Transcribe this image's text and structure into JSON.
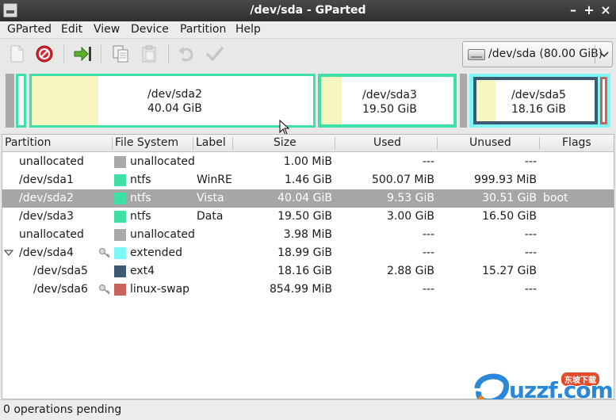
{
  "window": {
    "title": "/dev/sda - GParted",
    "controls": [
      "–",
      "+",
      "×"
    ]
  },
  "menu": [
    {
      "label": "GParted"
    },
    {
      "label": "Edit"
    },
    {
      "label": "View"
    },
    {
      "label": "Device"
    },
    {
      "label": "Partition"
    },
    {
      "label": "Help"
    }
  ],
  "toolbar": {
    "buttons": [
      "new-partition",
      "delete",
      "resize-move",
      "copy",
      "paste",
      "undo",
      "apply"
    ]
  },
  "device": {
    "label": "/dev/sda  (80.00 GiB)"
  },
  "map": [
    {
      "name": "/dev/sda2",
      "size": "40.04 GiB",
      "used_fraction": 0.238
    },
    {
      "name": "/dev/sda3",
      "size": "19.50 GiB",
      "used_fraction": 0.154
    },
    {
      "name": "/dev/sda5",
      "size": "18.16 GiB",
      "used_fraction": 0.159
    }
  ],
  "table": {
    "headers": [
      "Partition",
      "File System",
      "Label",
      "Size",
      "Used",
      "Unused",
      "Flags"
    ],
    "rows": [
      {
        "partition": "unallocated",
        "fs": "unallocated",
        "label": "",
        "size": "1.00 MiB",
        "used": "---",
        "unused": "---",
        "flags": "",
        "color": "#a9a9a9"
      },
      {
        "partition": "/dev/sda1",
        "fs": "ntfs",
        "label": "WinRE",
        "size": "1.46 GiB",
        "used": "500.07 MiB",
        "unused": "999.93 MiB",
        "flags": "",
        "color": "#3fe0a5"
      },
      {
        "partition": "/dev/sda2",
        "fs": "ntfs",
        "label": "Vista",
        "size": "40.04 GiB",
        "used": "9.53 GiB",
        "unused": "30.51 GiB",
        "flags": "boot",
        "color": "#3fe0a5"
      },
      {
        "partition": "/dev/sda3",
        "fs": "ntfs",
        "label": "Data",
        "size": "19.50 GiB",
        "used": "3.00 GiB",
        "unused": "16.50 GiB",
        "flags": "",
        "color": "#3fe0a5"
      },
      {
        "partition": "unallocated",
        "fs": "unallocated",
        "label": "",
        "size": "3.98 MiB",
        "used": "---",
        "unused": "---",
        "flags": "",
        "color": "#a9a9a9"
      },
      {
        "partition": "/dev/sda4",
        "fs": "extended",
        "label": "",
        "size": "18.99 GiB",
        "used": "---",
        "unused": "---",
        "flags": "",
        "color": "#7ff7f7"
      },
      {
        "partition": "/dev/sda5",
        "fs": "ext4",
        "label": "",
        "size": "18.16 GiB",
        "used": "2.88 GiB",
        "unused": "15.27 GiB",
        "flags": "",
        "color": "#3e5a72"
      },
      {
        "partition": "/dev/sda6",
        "fs": "linux-swap",
        "label": "",
        "size": "854.99 MiB",
        "used": "---",
        "unused": "---",
        "flags": "",
        "color": "#c8645c"
      }
    ]
  },
  "status": {
    "text": "0 operations pending"
  },
  "watermark": {
    "text": "uzzf.com",
    "badge": "东坡下载"
  },
  "colors": {
    "ntfs": "#3fe0a5",
    "ext4": "#3e5a72",
    "extended": "#7ff7f7",
    "unallocated": "#a9a9a9",
    "linux_swap": "#c8645c",
    "used": "#f8f6c0",
    "selection": "#a6a6a5"
  }
}
